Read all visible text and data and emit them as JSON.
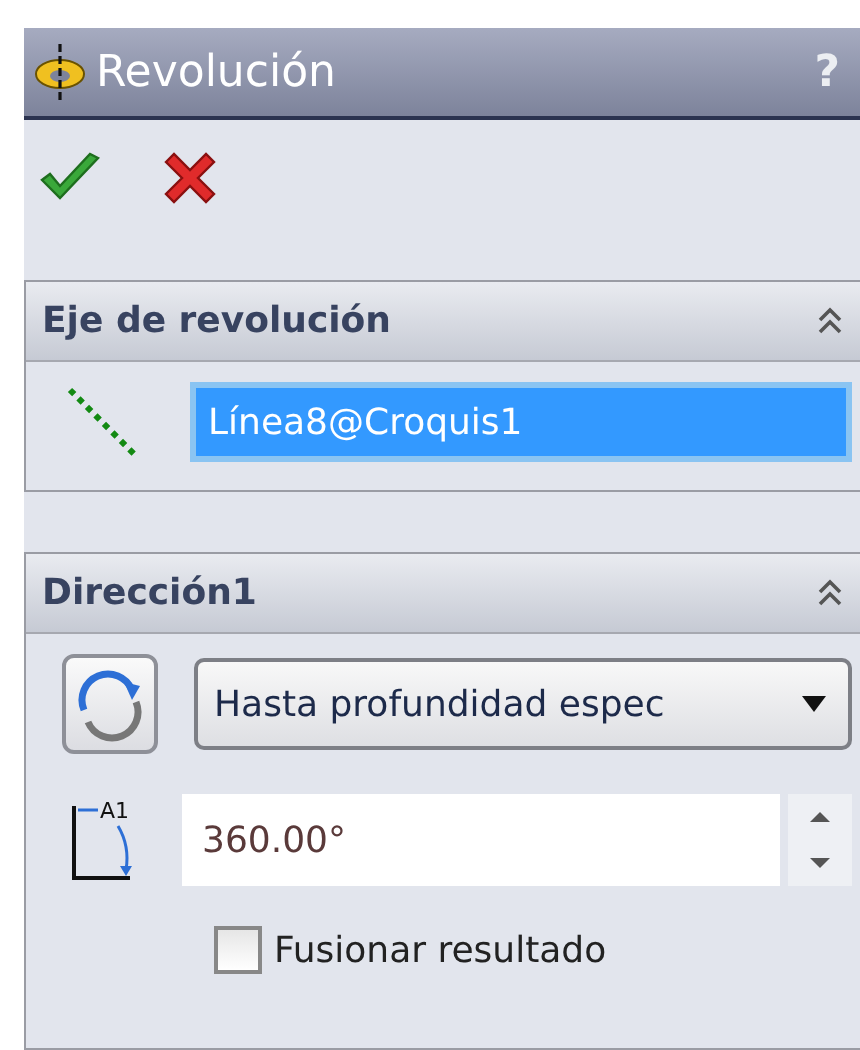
{
  "window": {
    "title": "Revolución",
    "help": "?"
  },
  "actions": [
    {
      "kind": "ok"
    },
    {
      "kind": "cancel"
    }
  ],
  "axis_section": {
    "title": "Eje de revolución",
    "expanded": true,
    "axis": {
      "value": "Línea8@Croquis1",
      "selected": true
    }
  },
  "direction_section": {
    "title": "Dirección1",
    "expanded": true,
    "end_condition": {
      "value": "Hasta profundidad espec"
    },
    "angle": {
      "icon_label": "A1",
      "value": "360.00°"
    },
    "merge_result": {
      "label": "Fusionar resultado",
      "checked": false
    }
  }
}
